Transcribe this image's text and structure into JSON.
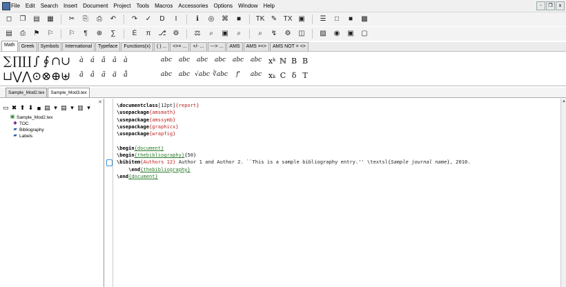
{
  "menu": [
    "File",
    "Edit",
    "Search",
    "Insert",
    "Document",
    "Project",
    "Tools",
    "Macros",
    "Accessories",
    "Options",
    "Window",
    "Help"
  ],
  "window_controls": [
    "-",
    "❐",
    "x"
  ],
  "toolbar1": [
    "◻",
    "❐",
    "▤",
    "▦",
    "✂",
    "⎘",
    "⎙",
    "↶",
    "↷",
    "✓",
    "D",
    "I",
    "ℹ",
    "◎",
    "⌘",
    "■",
    "TK",
    "✎",
    "TX",
    "▣",
    "☰",
    "□",
    "■",
    "▩"
  ],
  "toolbar2": [
    "▤",
    "⎙",
    "⚑",
    "⚐",
    "⚐",
    "¶",
    "⊕",
    "∑",
    "É",
    "π",
    "⎇",
    "⚙",
    "⚖",
    "⌕",
    "▣",
    "⌕",
    "⌕",
    "↯",
    "⚙",
    "◫",
    "▨",
    "◉",
    "▣",
    "▢"
  ],
  "math_tabs": [
    "Math",
    "Greek",
    "Symbols",
    "International",
    "Typeface",
    "Functions(x)",
    "( ) ...",
    "<>= ...",
    "+/- ...",
    "---> ...",
    "AMS",
    "AMS =<>",
    "AMS NOT = <>"
  ],
  "symbols": {
    "row1_big": [
      "∑",
      "∏",
      "∐",
      "∫",
      "∮",
      "∩",
      "∪"
    ],
    "row2_big": [
      "⊔",
      "⋁",
      "⋀",
      "⊙",
      "⊗",
      "⊕",
      "⊎"
    ],
    "row1_acc": [
      "à",
      "á",
      "ǎ",
      "ă",
      "à"
    ],
    "row2_acc": [
      "ā",
      "â",
      "ã",
      "ä",
      "å"
    ],
    "row1_wide": [
      "abc",
      "abc",
      "abc",
      "abc",
      "abc",
      "abc"
    ],
    "row2_wide": [
      "abc",
      "abc",
      "√abc",
      "∛abc",
      "f'",
      "abc"
    ],
    "row1_ext": [
      "xᵏ",
      "ℕ",
      "B",
      "B"
    ],
    "row2_ext": [
      "xₖ",
      "C",
      "δ",
      "T"
    ]
  },
  "file_tabs": [
    "Sample_Mod2.tex",
    "Sample_Mod3.tex"
  ],
  "structure": {
    "toolbar_icons": [
      "▭",
      "✖",
      "⬆",
      "⬇",
      "■",
      "▤",
      "▾",
      "▤",
      "▾",
      "▥",
      "▾"
    ],
    "items": [
      "Sample_Mod2.tex",
      "TOC",
      "Bibliography",
      "Labels"
    ]
  },
  "editor_lines": [
    {
      "cmd": "\\documentclass",
      "opt": "[12pt]",
      "arg": "{report}"
    },
    {
      "cmd": "\\usepackage",
      "arg": "{amsmath}"
    },
    {
      "cmd": "\\usepackage",
      "arg": "{amssymb}"
    },
    {
      "cmd": "\\usepackage",
      "arg": "{graphicx}"
    },
    {
      "cmd": "\\usepackage",
      "arg": "{wrapfig}"
    },
    {
      "text": ""
    },
    {
      "cmd": "\\begin",
      "env": "{document}"
    },
    {
      "cmd": "\\begin",
      "env": "{thebibliography}",
      "rest": "{50}"
    },
    {
      "cmd": "\\bibitem",
      "arg": "{Authors 12}",
      "rest": " Author 1 and Author 2. ``This is a sample bibliography entry.'' \\textsl{",
      "it": "Sample journal name",
      "tail": "}, 2010."
    },
    {
      "indent": "    ",
      "cmd": "\\end",
      "env": "{thebibliography}"
    },
    {
      "cmd": "\\end",
      "env": "{document}"
    }
  ]
}
